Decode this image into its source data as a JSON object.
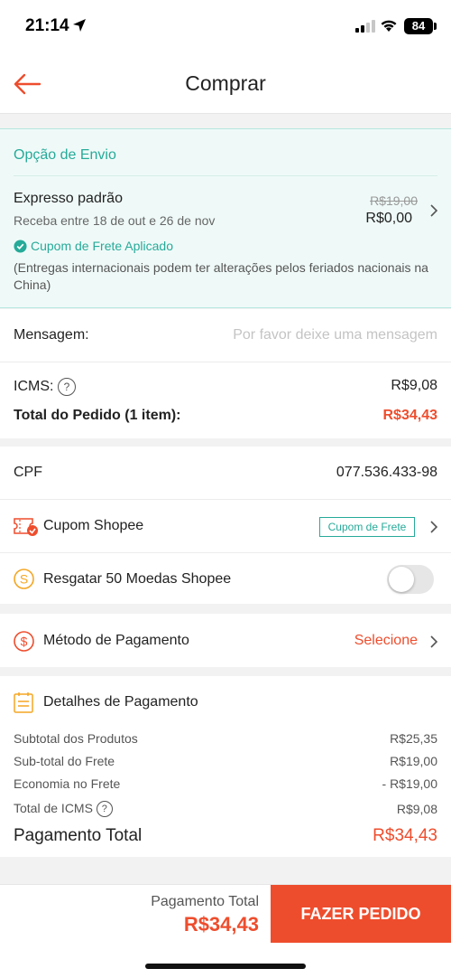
{
  "status_bar": {
    "time": "21:14",
    "battery": "84"
  },
  "header": {
    "title": "Comprar"
  },
  "shipping": {
    "section_title": "Opção de Envio",
    "method": "Expresso padrão",
    "delivery_window": "Receba entre 18 de out e 26 de nov",
    "original_price": "R$19,00",
    "price": "R$0,00",
    "coupon_applied": "Cupom de Frete Aplicado",
    "note": "(Entregas internacionais podem ter alterações pelos feriados nacionais na China)"
  },
  "message": {
    "label": "Mensagem:",
    "placeholder": "Por favor deixe uma mensagem"
  },
  "order_summary": {
    "icms_label": "ICMS:",
    "icms_value": "R$9,08",
    "total_label": "Total do Pedido (1 item):",
    "total_value": "R$34,43"
  },
  "cpf": {
    "label": "CPF",
    "value": "077.536.433-98"
  },
  "coupon": {
    "label": "Cupom Shopee",
    "tag": "Cupom de Frete"
  },
  "coins": {
    "label": "Resgatar 50 Moedas Shopee",
    "enabled": false
  },
  "payment_method": {
    "label": "Método de Pagamento",
    "action": "Selecione"
  },
  "payment_details": {
    "title": "Detalhes de Pagamento",
    "rows": [
      {
        "label": "Subtotal dos Produtos",
        "value": "R$25,35"
      },
      {
        "label": "Sub-total do Frete",
        "value": "R$19,00"
      },
      {
        "label": "Economia no Frete",
        "value": "- R$19,00"
      },
      {
        "label": "Total de ICMS",
        "value": "R$9,08"
      }
    ],
    "total_label": "Pagamento Total",
    "total_value": "R$34,43"
  },
  "bottom_bar": {
    "label": "Pagamento Total",
    "total": "R$34,43",
    "button": "FAZER PEDIDO"
  },
  "colors": {
    "accent": "#ee4d2d",
    "teal": "#26aa99",
    "coin": "#f5a623"
  }
}
